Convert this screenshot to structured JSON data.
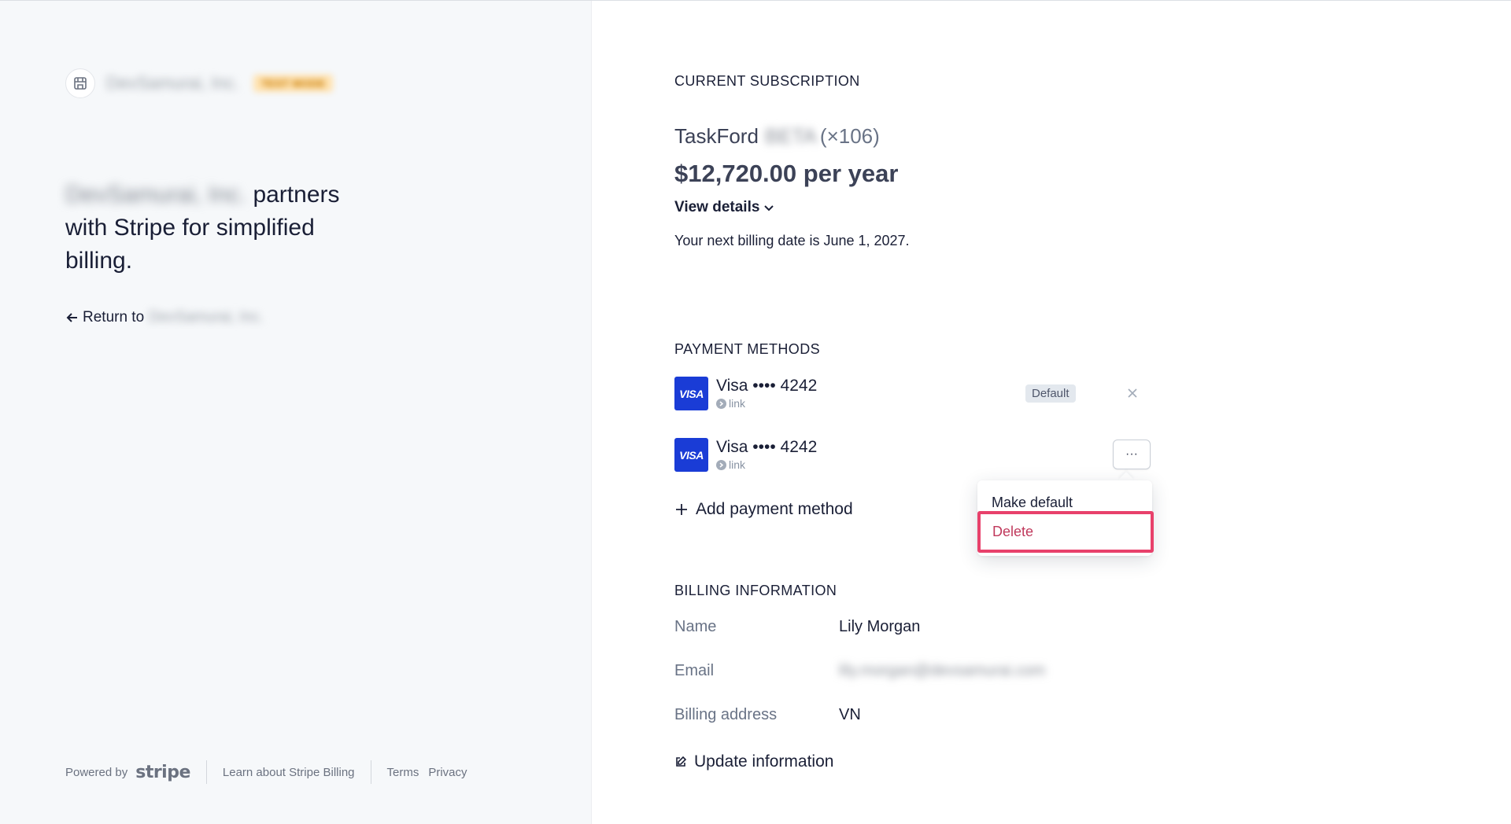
{
  "merchant": {
    "name": "DevSamurai, Inc.",
    "badge": "TEST MODE",
    "tagline_suffix": "partners with Stripe for simplified billing.",
    "return_label": "Return to",
    "return_target": "DevSamurai, Inc."
  },
  "footer": {
    "powered_by": "Powered by",
    "stripe_logo": "stripe",
    "learn": "Learn about Stripe Billing",
    "terms": "Terms",
    "privacy": "Privacy"
  },
  "subscription": {
    "section_title": "CURRENT SUBSCRIPTION",
    "product": "TaskFord",
    "plan_tier": "BETA",
    "quantity": "(×106)",
    "price": "$12,720.00 per year",
    "view_details": "View details",
    "next_billing": "Your next billing date is June 1, 2027."
  },
  "payment_methods": {
    "section_title": "PAYMENT METHODS",
    "items": [
      {
        "brand": "VISA",
        "label": "Visa •••• 4242",
        "sub": "link",
        "badge": "Default"
      },
      {
        "brand": "VISA",
        "label": "Visa •••• 4242",
        "sub": "link",
        "badge": ""
      }
    ],
    "more_label": "···",
    "add_label": "Add payment method",
    "menu": {
      "make_default": "Make default",
      "delete": "Delete"
    }
  },
  "billing": {
    "section_title": "BILLING INFORMATION",
    "name_label": "Name",
    "name_value": "Lily Morgan",
    "email_label": "Email",
    "email_value": "lily.morgan@devsamurai.com",
    "address_label": "Billing address",
    "address_value": "VN",
    "update_label": "Update information"
  },
  "colors": {
    "accent_danger": "#e8416b",
    "visa_blue": "#1a3cd6",
    "panel_bg": "#f6f8fa"
  }
}
